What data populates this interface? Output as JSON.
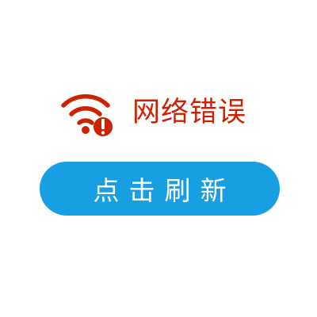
{
  "status": {
    "message": "网络错误",
    "icon": "wifi-error-icon",
    "color": "#cc2200"
  },
  "refresh_button": {
    "label": "点击刷新",
    "background": "#189fe3",
    "text_color": "#ffffff"
  }
}
